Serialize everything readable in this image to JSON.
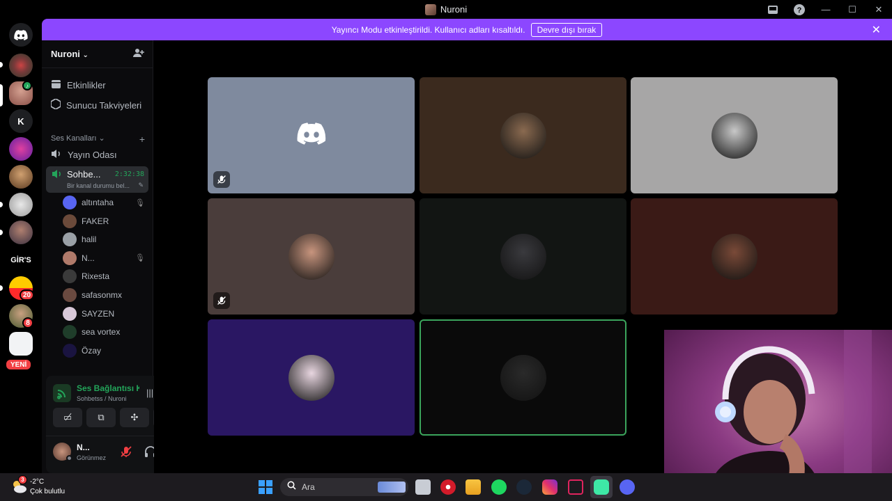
{
  "window": {
    "title": "Nuroni"
  },
  "banner": {
    "message": "Yayıncı Modu etkinleştirildi. Kullanıcı adları kısaltıldı.",
    "action_label": "Devre dışı bırak"
  },
  "rail": {
    "letter_server": "K",
    "text_server": "GİR'S",
    "badge_1": "20",
    "badge_2": "8",
    "new_label": "YENİ"
  },
  "sidebar": {
    "guild_name": "Nuroni",
    "items": [
      {
        "label": "Etkinlikler"
      },
      {
        "label": "Sunucu Takviyeleri"
      }
    ],
    "voice_category": "Ses Kanalları",
    "channels": [
      {
        "label": "Yayın Odası"
      },
      {
        "label": "Sohbe...",
        "timer": "2:32:38",
        "status": "Bir kanal durumu bel..."
      }
    ],
    "users": [
      {
        "name": "altıntaha",
        "muted": true,
        "color": "#5865f2"
      },
      {
        "name": "FAKER",
        "muted": false,
        "color": "#6b4a3a"
      },
      {
        "name": "halil",
        "muted": false,
        "color": "#9aa0a6"
      },
      {
        "name": "N...",
        "muted": true,
        "color": "#b07a6a"
      },
      {
        "name": "Rixesta",
        "muted": false,
        "color": "#3a3a3a"
      },
      {
        "name": "safasonmx",
        "muted": false,
        "color": "#6a4a40"
      },
      {
        "name": "SAYZEN",
        "muted": false,
        "color": "#d8c8d8"
      },
      {
        "name": "sea vortex",
        "muted": false,
        "color": "#1f3d2a"
      },
      {
        "name": "Özay",
        "muted": false,
        "color": "#1a1440"
      }
    ]
  },
  "voice_panel": {
    "status": "Ses Bağlantısı K",
    "location": "Sohbetss / Nuroni"
  },
  "user_panel": {
    "name": "N...",
    "status": "Görünmez"
  },
  "tiles": [
    {
      "bg": "#7f8a9e",
      "avatar": "discord",
      "muted": true
    },
    {
      "bg": "#3b2a1e",
      "avatar": "#8a6a50",
      "muted": false
    },
    {
      "bg": "#a7a6a6",
      "avatar": "#c8c8c8",
      "muted": false
    },
    {
      "bg": "#4a3d3b",
      "avatar": "#c8957e",
      "muted": true
    },
    {
      "bg": "#121513",
      "avatar": "#3a3a3e",
      "muted": false
    },
    {
      "bg": "#3a1a16",
      "avatar": "#7a4a38",
      "muted": false
    },
    {
      "bg": "#2a1763",
      "avatar": "#e8d6e0",
      "muted": false
    },
    {
      "bg": "#0a0a0a",
      "avatar": "#2a2a2a",
      "muted": false,
      "speaking": true
    }
  ],
  "weather": {
    "temp": "-2°C",
    "desc": "Çok bulutlu",
    "badge": "3"
  },
  "taskbar": {
    "search_placeholder": "Ara"
  }
}
